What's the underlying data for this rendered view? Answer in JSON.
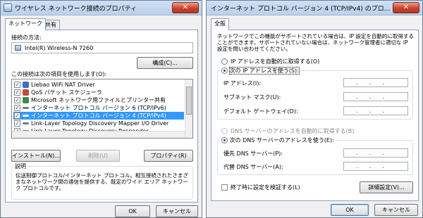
{
  "left": {
    "title": "ワイヤレス ネットワーク接続のプロパティ",
    "close_glyph": "✕",
    "tabs": [
      "ネットワーク",
      "共有"
    ],
    "connect_using_label": "接続の方法:",
    "adapter_name": "Intel(R) Wireless-N 7260",
    "configure_button": "構成(C)...",
    "items_label": "この接続は次の項目を使用します(O):",
    "items": [
      {
        "label": "Liebao WiFi NAT Driver",
        "checked": true,
        "selected": false,
        "icon_color": "#3a6fc4"
      },
      {
        "label": "QoS パケット スケジューラ",
        "checked": true,
        "selected": false,
        "icon_color": "#c44a3a"
      },
      {
        "label": "Microsoft ネットワーク用ファイルとプリンター共有",
        "checked": true,
        "selected": false,
        "icon_color": "#3a8c4a"
      },
      {
        "label": "インターネット プロトコル バージョン 6 (TCP/IPv6)",
        "checked": true,
        "selected": false,
        "icon_color": "#7a7a7a"
      },
      {
        "label": "インターネット プロトコル バージョン 4 (TCP/IPv4)",
        "checked": true,
        "selected": true,
        "icon_color": "#7a7a7a"
      },
      {
        "label": "Link-Layer Topology Discovery Mapper I/O Driver",
        "checked": true,
        "selected": false,
        "icon_color": "#7a7a7a"
      },
      {
        "label": "Link-Layer Topology Discovery Responder",
        "checked": true,
        "selected": false,
        "icon_color": "#7a7a7a"
      }
    ],
    "install_button": "インストール(N)...",
    "uninstall_button": "削除(U)",
    "properties_button": "プロパティ(R)",
    "description_title": "説明",
    "description_text": "伝送制御プロトコル/インターネット プロトコル。相互接続されたさまざまなネットワーク間の通信を提供する、既定のワイド エリア ネットワーク プロトコルです。",
    "ok_button": "OK",
    "cancel_button": "キャンセル"
  },
  "right": {
    "title": "インターネット プロトコル バージョン 4 (TCP/IPv4) のプロ...",
    "close_glyph": "✕",
    "tab": "全般",
    "intro_text": "ネットワークでこの機能がサポートされている場合は、IP 設定を自動的に取得することができます。サポートされていない場合は、ネットワーク管理者に適切な IP 設定を問い合わせてください。",
    "ip_auto_label": "IP アドレスを自動的に取得する(O)",
    "ip_manual_label": "次の IP アドレスを使う(S):",
    "ip_address_label": "IP アドレス(I):",
    "subnet_label": "サブネット マスク(U):",
    "gateway_label": "デフォルト ゲートウェイ(D):",
    "dns_auto_label": "DNS サーバーのアドレスを自動的に取得する(B)",
    "dns_manual_label": "次の DNS サーバーのアドレスを使う(E):",
    "dns_preferred_label": "優先 DNS サーバー(P):",
    "dns_alternate_label": "代替 DNS サーバー(A):",
    "ip_placeholder": "...",
    "validate_label": "終了時に設定を検証する(L)",
    "advanced_button": "詳細設定(V)...",
    "ok_button": "OK",
    "cancel_button": "キャンセル"
  }
}
